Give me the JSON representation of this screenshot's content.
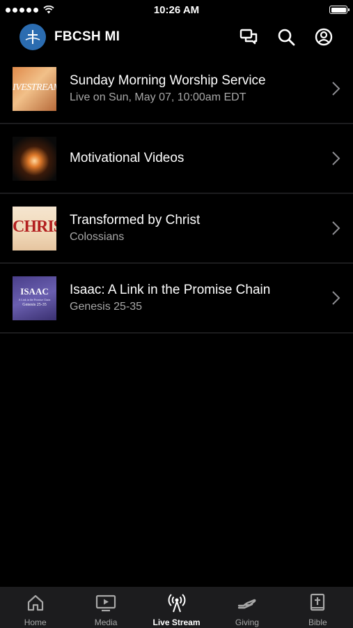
{
  "status_bar": {
    "time": "10:26 AM"
  },
  "header": {
    "title": "FBCSH MI"
  },
  "items": [
    {
      "title": "Sunday Morning Worship Service",
      "subtitle": "Live on Sun, May 07, 10:00am EDT",
      "thumb_text": "IVESTREAM"
    },
    {
      "title": "Motivational Videos",
      "subtitle": ""
    },
    {
      "title": "Transformed by Christ",
      "subtitle": "Colossians",
      "thumb_text": "CHRIST"
    },
    {
      "title": "Isaac: A Link in the Promise Chain",
      "subtitle": "Genesis 25-35",
      "thumb_text": "ISAAC",
      "thumb_caption": "A Link in the Promise Chain",
      "thumb_ref": "Genesis 25-35"
    }
  ],
  "tabs": [
    {
      "label": "Home",
      "icon": "home-icon",
      "active": false
    },
    {
      "label": "Media",
      "icon": "media-icon",
      "active": false
    },
    {
      "label": "Live Stream",
      "icon": "live-stream-icon",
      "active": true
    },
    {
      "label": "Giving",
      "icon": "giving-icon",
      "active": false
    },
    {
      "label": "Bible",
      "icon": "bible-icon",
      "active": false
    }
  ],
  "colors": {
    "background": "#000000",
    "tab_bar": "#1c1c1e",
    "subtitle": "#a8a8a8",
    "logo": "#2b6cb0"
  }
}
